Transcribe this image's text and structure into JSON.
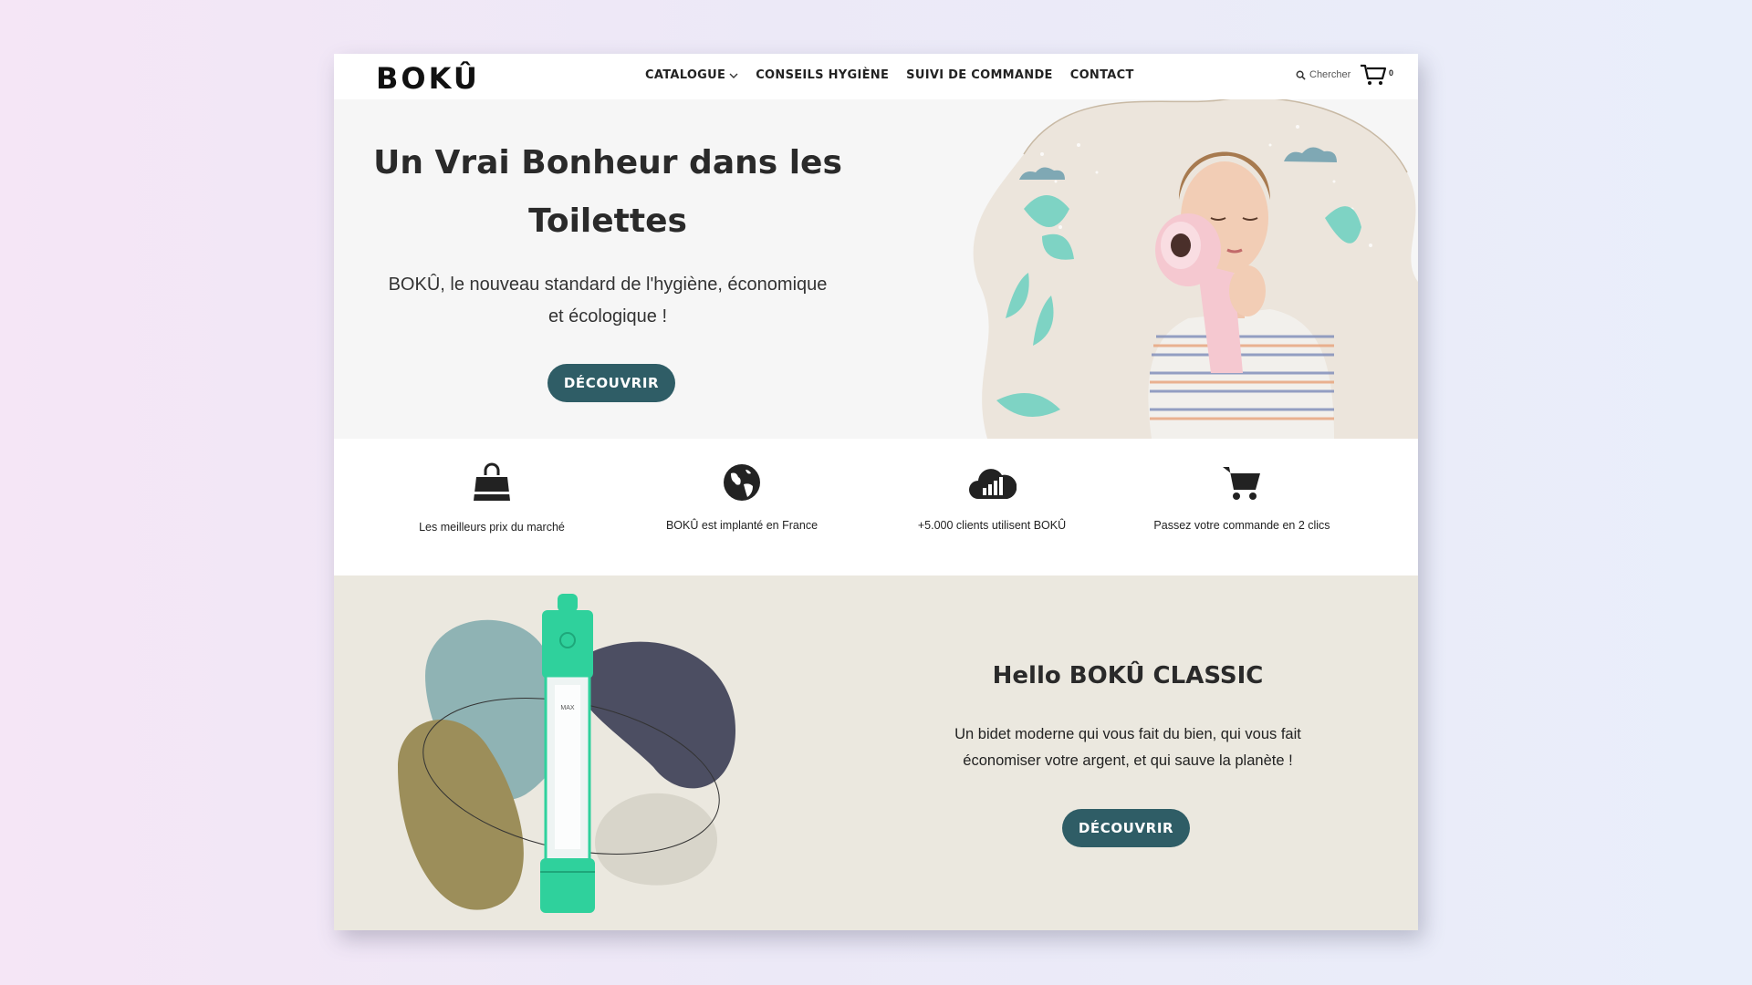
{
  "header": {
    "logo": "BOKÛ",
    "nav": [
      {
        "label": "CATALOGUE",
        "has_dropdown": true
      },
      {
        "label": "CONSEILS HYGIÈNE"
      },
      {
        "label": "SUIVI DE COMMANDE"
      },
      {
        "label": "CONTACT"
      }
    ],
    "search_label": "Chercher",
    "cart_count": "0"
  },
  "hero": {
    "title_line1": "Un Vrai Bonheur dans les",
    "title_line2": "Toilettes",
    "subtitle_line1": "BOKÛ, le nouveau standard de l'hygiène, économique",
    "subtitle_line2": "et écologique !",
    "cta": "DÉCOUVRIR"
  },
  "features": [
    {
      "icon": "shopping-bag-icon",
      "label": "Les meilleurs prix du marché"
    },
    {
      "icon": "globe-icon",
      "label": "BOKÛ est implanté en France"
    },
    {
      "icon": "cloud-chart-icon",
      "label": "+5.000 clients utilisent BOKÛ"
    },
    {
      "icon": "cart-icon",
      "label": "Passez votre commande en 2 clics"
    }
  ],
  "product": {
    "title": "Hello BOKÛ CLASSIC",
    "desc_line1": "Un bidet moderne qui vous fait du bien, qui vous fait",
    "desc_line2": "économiser votre argent, et qui sauve la planète !",
    "cta": "DÉCOUVRIR",
    "bottle_mark": "MAX"
  },
  "colors": {
    "accent": "#2f5d66",
    "hero_bg": "#f6f6f6",
    "product_bg": "#ebe8df",
    "bottle": "#2fd19c"
  }
}
